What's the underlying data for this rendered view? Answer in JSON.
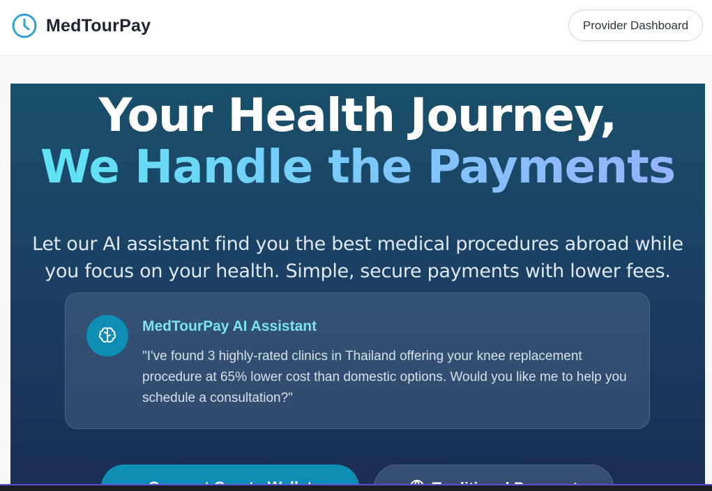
{
  "header": {
    "brand_name": "MedTourPay",
    "brand_icon": "clock-icon",
    "provider_button_label": "Provider Dashboard"
  },
  "hero": {
    "headline_line1": "Your Health Journey,",
    "headline_line2": "We Handle the Payments",
    "subtitle": "Let our AI assistant find you the best medical procedures abroad while you focus on your health. Simple, secure payments with lower fees."
  },
  "ai_card": {
    "icon": "brain-icon",
    "title": "MedTourPay AI Assistant",
    "message": "\"I've found 3 highly-rated clinics in Thailand offering your knee replacement procedure at 65% lower cost than domestic options. Would you like me to help you schedule a consultation?\""
  },
  "cta": {
    "primary_label": "Connect Crypto Wallet",
    "secondary_icon": "globe-icon",
    "secondary_label": "Traditional Payment"
  },
  "colors": {
    "accent": "#0e8db5",
    "gradient_cyan": "#5ee3f4",
    "gradient_blue": "#96b3ff",
    "hero_top": "#19506a",
    "hero_bottom": "#1b2d55"
  }
}
